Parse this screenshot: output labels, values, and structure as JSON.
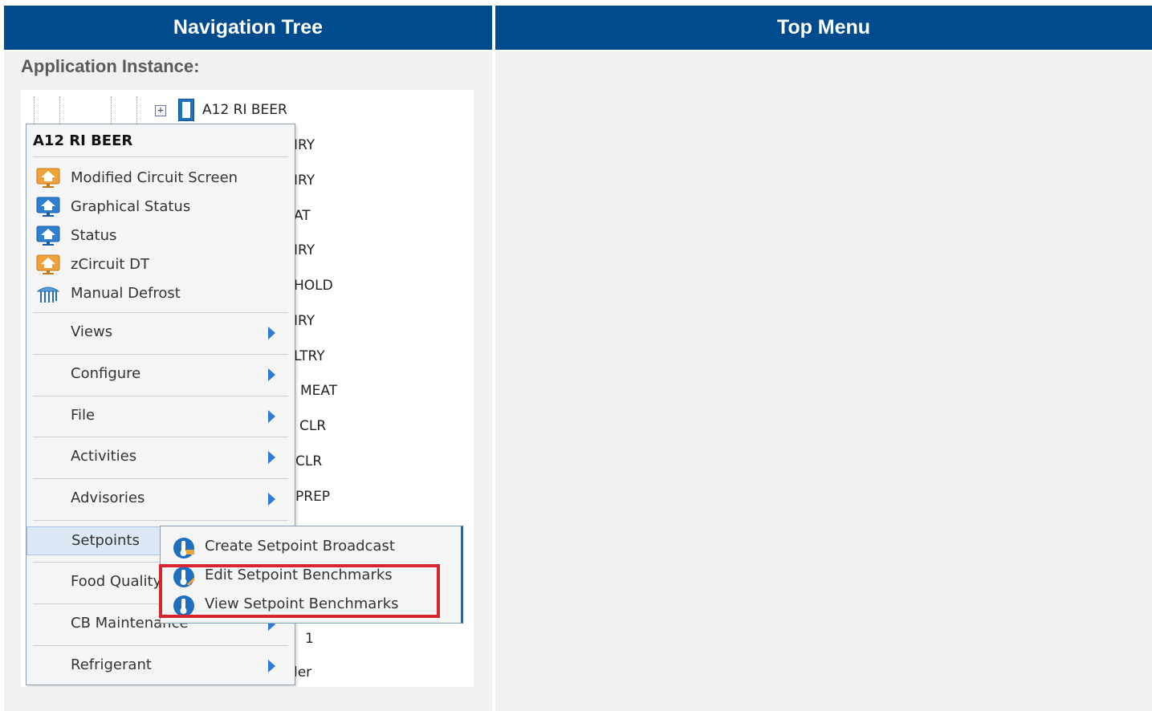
{
  "headers": {
    "navigation_tree": "Navigation Tree",
    "top_menu": "Top Menu"
  },
  "application_instance_label": "Application Instance:",
  "tree": {
    "root": "A12 RI BEER",
    "items": [
      "IRY",
      "IRY",
      "AT",
      "IRY",
      "HOLD",
      "IRY",
      "LTRY",
      "MEAT",
      "CLR",
      "CLR",
      "PREP",
      "1",
      "ler"
    ]
  },
  "context_menu": {
    "title": "A12 RI BEER",
    "quick_items": [
      {
        "label": "Modified Circuit Screen",
        "icon": "orange-screen-icon"
      },
      {
        "label": "Graphical Status",
        "icon": "blue-screen-icon"
      },
      {
        "label": "Status",
        "icon": "blue-screen-icon"
      },
      {
        "label": "zCircuit DT",
        "icon": "orange-screen-icon"
      },
      {
        "label": "Manual Defrost",
        "icon": "defrost-icon"
      }
    ],
    "submenus": [
      "Views",
      "Configure",
      "File",
      "Activities",
      "Advisories",
      "Setpoints",
      "Food Quality",
      "CB Maintenance",
      "Refrigerant"
    ]
  },
  "setpoints_submenu": {
    "items": [
      {
        "label": "Create Setpoint Broadcast",
        "icon": "setpoint-broadcast-icon"
      },
      {
        "label": "Edit Setpoint Benchmarks",
        "icon": "edit-benchmark-icon"
      },
      {
        "label": "View Setpoint Benchmarks",
        "icon": "view-benchmark-icon"
      }
    ],
    "highlighted": [
      "Edit Setpoint Benchmarks",
      "View Setpoint Benchmarks"
    ]
  },
  "colors": {
    "header_bg": "#004b8d",
    "panel_bg": "#f1f1f1",
    "highlight_border": "#d7262e",
    "submenu_arrow": "#2d7bd4"
  }
}
